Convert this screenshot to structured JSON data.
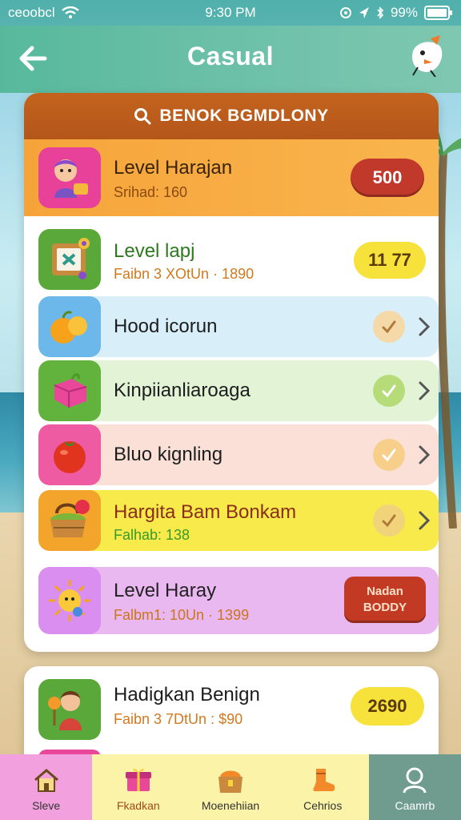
{
  "status_bar": {
    "carrier": "ceoobcl",
    "time": "9:30 PM",
    "battery": "99%"
  },
  "header": {
    "title": "Casual"
  },
  "panel": {
    "heading": "BENOK BGMDLONY"
  },
  "rows": [
    {
      "title": "Level Harajan",
      "subtitle": "Srihad: 160",
      "badge": "500",
      "icon": "baby-doll-icon"
    },
    {
      "title": "Level lapj",
      "subtitle": "Faibn 3 XOtUn · 1890",
      "badge": "11 77",
      "icon": "puzzle-board-icon"
    },
    {
      "title": "Hood icorun",
      "icon": "fruit-icon"
    },
    {
      "title": "Kinpiianliaroaga",
      "icon": "gift-box-icon"
    },
    {
      "title": "Bluo kignling",
      "icon": "tomato-icon"
    },
    {
      "title": "Hargita Bam Bonkam",
      "subtitle": "Falhab: 138",
      "icon": "basket-icon"
    },
    {
      "title": "Level Haray",
      "subtitle": "Falbm1: 10Un · 1399",
      "badge": "Nadan BODDY",
      "icon": "sun-character-icon"
    }
  ],
  "card2": {
    "title": "Hadigkan Benign",
    "subtitle": "Faibn 3 7DtUn : $90",
    "badge": "2690"
  },
  "tabbar": {
    "tabs": [
      {
        "label": "Sleve",
        "icon": "home-icon"
      },
      {
        "label": "Fkadkan",
        "icon": "gift-icon"
      },
      {
        "label": "Moenehiian",
        "icon": "chest-icon"
      },
      {
        "label": "Cehrios",
        "icon": "boot-icon"
      },
      {
        "label": "Caamrb",
        "icon": "profile-icon"
      }
    ]
  },
  "colors": {
    "header_green": "#57b99c",
    "panel_head": "#c4631e",
    "badge_red": "#c0392b",
    "badge_yellow": "#f6e23a"
  }
}
